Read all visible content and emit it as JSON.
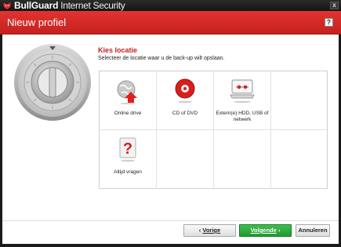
{
  "window": {
    "brand_name": "BullGuard",
    "product_name": "Internet Security",
    "close_label": "x"
  },
  "header": {
    "title": "Nieuw profiel",
    "help_label": "?"
  },
  "main": {
    "section_title": "Kies locatie",
    "section_subtitle": "Selecteer de locatie waar u de back-up wilt opslaan.",
    "options": [
      {
        "label": "Online drive",
        "icon": "online-drive-icon"
      },
      {
        "label": "CD of DVD",
        "icon": "cd-dvd-icon"
      },
      {
        "label": "Extern(e) HDD, USB of netwerk",
        "icon": "external-drive-icon"
      },
      {
        "label": "Altijd vragen",
        "icon": "question-icon"
      }
    ]
  },
  "footer": {
    "prev_label": "Vorige",
    "next_label": "Volgende",
    "cancel_label": "Annuleren"
  },
  "colors": {
    "accent_red": "#cc2020",
    "header_red": "#d92b28",
    "next_green": "#2aa83a"
  }
}
